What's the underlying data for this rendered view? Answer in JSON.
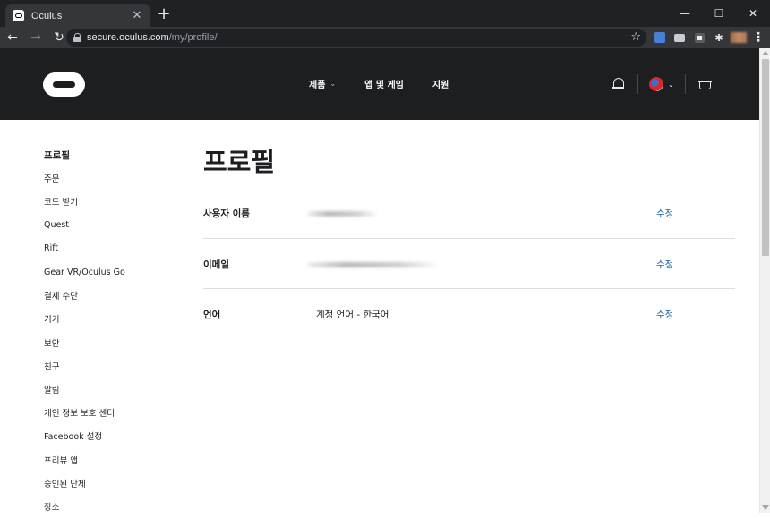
{
  "browser": {
    "tab_title": "Oculus",
    "tab_close": "✕",
    "new_tab": "+",
    "url_host": "secure.oculus.com",
    "url_path": "/my/profile/",
    "window": {
      "minimize": "—",
      "maximize": "☐",
      "close": "✕"
    },
    "nav": {
      "back": "←",
      "forward": "→",
      "reload": "↻"
    },
    "star": "☆",
    "puzzle": "✱",
    "menu": "⋮"
  },
  "header": {
    "nav": [
      {
        "label": "제품",
        "has_dropdown": true
      },
      {
        "label": "앱 및 게임",
        "has_dropdown": false
      },
      {
        "label": "지원",
        "has_dropdown": false
      }
    ],
    "chevron": "⌄"
  },
  "sidebar": {
    "items": [
      {
        "label": "프로필",
        "active": true
      },
      {
        "label": "주문"
      },
      {
        "label": "코드 받기"
      },
      {
        "label": "Quest"
      },
      {
        "label": "Rift"
      },
      {
        "label": "Gear VR/Oculus Go"
      },
      {
        "label": "결제 수단"
      },
      {
        "label": "기기"
      },
      {
        "label": "보안"
      },
      {
        "label": "친구"
      },
      {
        "label": "알림"
      },
      {
        "label": "개인 정보 보호 센터"
      },
      {
        "label": "Facebook 설정"
      },
      {
        "label": "프리뷰 앱"
      },
      {
        "label": "승인된 단체"
      },
      {
        "label": "장소"
      }
    ]
  },
  "main": {
    "title": "프로필",
    "rows": [
      {
        "label": "사용자 이름",
        "value": "",
        "redacted": true,
        "edit": "수정"
      },
      {
        "label": "이메일",
        "value": "",
        "redacted": true,
        "edit": "수정"
      },
      {
        "label": "언어",
        "value": "계정 언어 - 한국어",
        "redacted": false,
        "edit": "수정"
      }
    ]
  },
  "colors": {
    "header_bg": "#1c1e20",
    "link": "#1a5fa0",
    "text": "#1c1e20",
    "divider": "#dadde1"
  }
}
